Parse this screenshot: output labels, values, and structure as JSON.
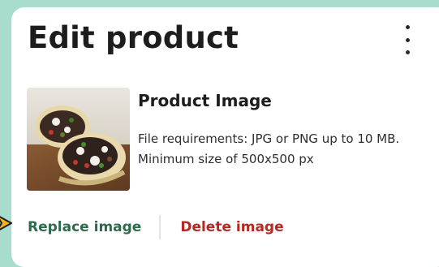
{
  "header": {
    "title": "Edit product",
    "menu_icon": "vertical-ellipsis-icon"
  },
  "product_image": {
    "heading": "Product Image",
    "requirements": "File requirements: JPG or PNG up to 10 MB. Minimum size of 500x500 px",
    "thumbnail": "burrito-photo"
  },
  "actions": {
    "replace_label": "Replace image",
    "delete_label": "Delete image"
  },
  "colors": {
    "background": "#a8dccf",
    "card": "#ffffff",
    "replace": "#2f6a4a",
    "delete": "#b42a23",
    "pointer": "#f2b21b"
  }
}
